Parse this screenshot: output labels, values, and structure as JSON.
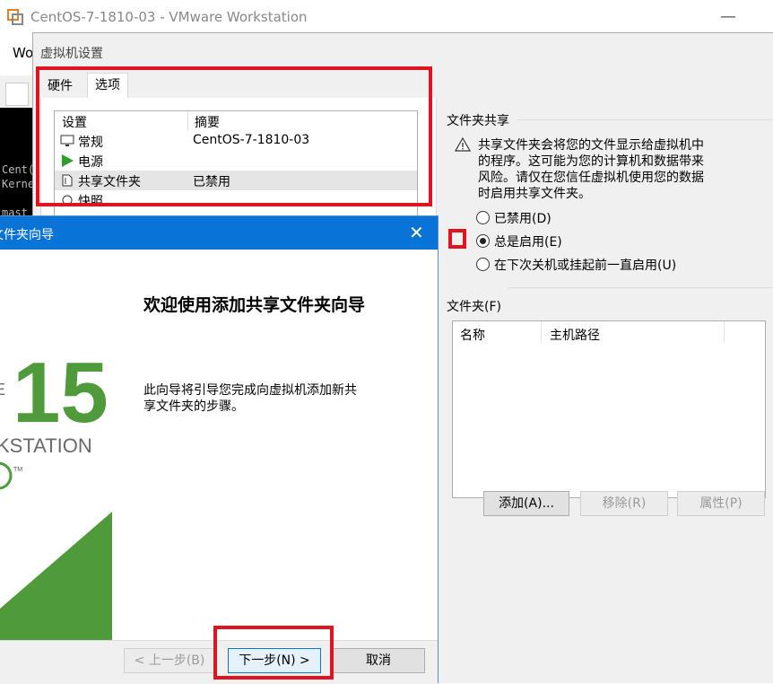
{
  "vmware": {
    "title": "CentOS-7-1810-03 - VMware Workstation",
    "menu_partial": "Wo",
    "minimize": "—",
    "console_lines": [
      "Cent(",
      "Kerne",
      "",
      "mast"
    ]
  },
  "settings": {
    "title": "虚拟机设置",
    "tabs": [
      "硬件",
      "选项"
    ],
    "list": {
      "headers": [
        "设置",
        "摘要"
      ],
      "rows": [
        {
          "name": "常规",
          "value": "CentOS-7-1810-03",
          "icon": "monitor-icon"
        },
        {
          "name": "电源",
          "value": "",
          "icon": "play-icon"
        },
        {
          "name": "共享文件夹",
          "value": "已禁用",
          "icon": "shared-folder-icon"
        },
        {
          "name": "快照",
          "value": "",
          "icon": "snapshot-icon"
        }
      ]
    },
    "share": {
      "group_label": "文件夹共享",
      "warning_lines": [
        "共享文件夹会将您的文件显示给虚拟机中",
        "的程序。这可能为您的计算机和数据带来",
        "风险。请仅在您信任虚拟机使用您的数据",
        "时启用共享文件夹。"
      ],
      "options": [
        {
          "label": "已禁用(D)",
          "selected": false
        },
        {
          "label": "总是启用(E)",
          "selected": true
        },
        {
          "label": "在下次关机或挂起前一直启用(U)",
          "selected": false
        }
      ]
    },
    "folders": {
      "label": "文件夹(F)",
      "headers": [
        "名称",
        "主机路径"
      ],
      "buttons": {
        "add": "添加(A)...",
        "remove": "移除(R)",
        "properties": "属性(P)"
      }
    }
  },
  "wizard": {
    "title": "文件夹向导",
    "close": "✕",
    "heading": "欢迎使用添加共享文件夹向导",
    "body_lines": [
      "此向导将引导您完成向虚拟机添加新共",
      "享文件夹的步骤。"
    ],
    "logo": {
      "number": "15",
      "brand_partial": "KSTATION",
      "prefix_partial": "E",
      "tm": "TM"
    },
    "buttons": {
      "back": "< 上一步(B)",
      "next": "下一步(N) >",
      "cancel": "取消"
    }
  },
  "colors": {
    "accent_blue": "#0a74d6",
    "highlight_red": "#e0141e",
    "logo_green": "#4f9a3a"
  }
}
